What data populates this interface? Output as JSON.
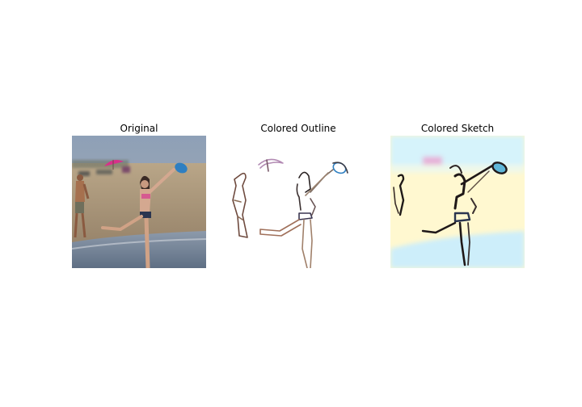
{
  "panels": [
    {
      "title": "Original"
    },
    {
      "title": "Colored Outline"
    },
    {
      "title": "Colored Sketch"
    }
  ],
  "colors": {
    "sky": "#8f9db0",
    "sand": "#b8a284",
    "sea": "#7e8ea3",
    "frisbee": "#2f7fc1",
    "umbrella": "#d8308a",
    "sketch_yellow": "#fff8c8",
    "sketch_cyan": "#d6f3fb",
    "outline_ink": "#3a2f2f"
  }
}
